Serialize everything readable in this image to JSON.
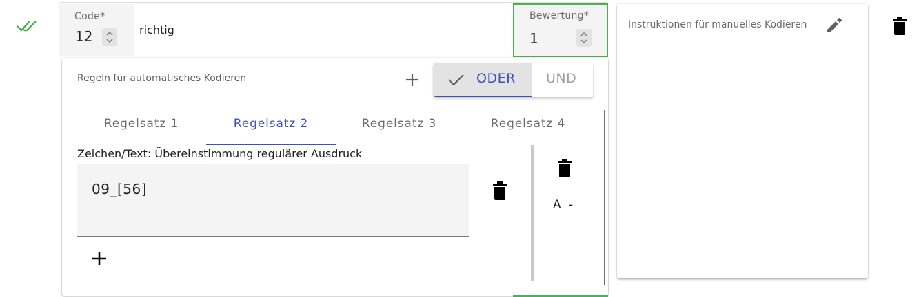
{
  "status": {
    "icon": "double-check-icon",
    "color": "#4caf50"
  },
  "code": {
    "label": "Code*",
    "value": "12",
    "title": "richtig"
  },
  "score": {
    "label": "Bewertung*",
    "value": "1",
    "border_color": "#4caf50"
  },
  "rules": {
    "header": "Regeln für automatisches Kodieren",
    "add_icon": "plus-icon",
    "operator_toggle": {
      "options": [
        "ODER",
        "UND"
      ],
      "selected": "ODER",
      "accent": "#3f51b5"
    },
    "tabs": [
      "Regelsatz 1",
      "Regelsatz 2",
      "Regelsatz 3",
      "Regelsatz 4"
    ],
    "active_tab": "Regelsatz 2",
    "condition": {
      "label": "Zeichen/Text: Übereinstimmung regulärer Ausdruck",
      "value": "09_[56]"
    },
    "ruleset_badge": "A -"
  },
  "instructions": {
    "label": "Instruktionen für manuelles Kodieren",
    "edit_icon": "pencil-icon"
  },
  "actions": {
    "delete_icon": "trash-icon"
  }
}
